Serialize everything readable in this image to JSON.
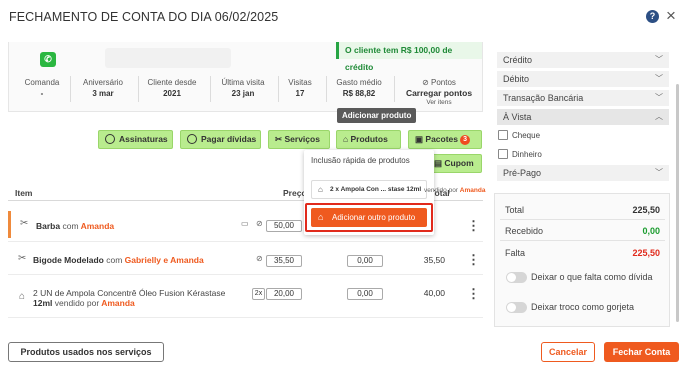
{
  "header": {
    "title": "FECHAMENTO DE CONTA DO DIA 06/02/2025",
    "help": "?",
    "close": "×"
  },
  "client": {
    "credit_banner": "O cliente tem R$ 100,00 de crédito",
    "stats": [
      {
        "label": "Comanda",
        "value": "-"
      },
      {
        "label": "Aniversário",
        "value": "3 mar"
      },
      {
        "label": "Cliente desde",
        "value": "2021"
      },
      {
        "label": "Última visita",
        "value": "23 jan"
      },
      {
        "label": "Visitas",
        "value": "17"
      },
      {
        "label": "Gasto médio",
        "value": "R$ 88,82"
      }
    ],
    "points": {
      "label": "Pontos",
      "button": "Carregar pontos",
      "link": "Ver itens"
    }
  },
  "tooltip": "Adicionar produto",
  "actions": {
    "assinaturas": "Assinaturas",
    "pagar_dividas": "Pagar dívidas",
    "servicos": "Serviços",
    "produtos": "Produtos",
    "pacotes": "Pacotes",
    "pacotes_badge": "3",
    "cupom": "Cupom"
  },
  "dropdown": {
    "title": "Inclusão rápida de produtos",
    "item": "2 x Ampola Con ... stase 12ml",
    "item_tail_prefix": "vendido por",
    "item_tail_name": "Amanda",
    "add_button": "Adicionar outro produto"
  },
  "table": {
    "headers": {
      "item": "Item",
      "price": "Preço",
      "total": "Total"
    },
    "rows": [
      {
        "name": "Barba",
        "connector": "com",
        "pro": "Amanda",
        "price": "50,00",
        "discount": "",
        "total": ""
      },
      {
        "name": "Bigode Modelado",
        "connector": "com",
        "pro": "Gabrielly e Amanda",
        "price": "35,50",
        "discount": "0,00",
        "total": "35,50"
      },
      {
        "line1": "2 UN de Ampola Concentrê Óleo Fusion Kérastase",
        "line2": "12ml",
        "connector": "vendido por",
        "pro": "Amanda",
        "qty": "2x",
        "price": "20,00",
        "discount": "0,00",
        "total": "40,00"
      }
    ]
  },
  "footer": {
    "produtos_usados": "Produtos usados nos serviços",
    "cancelar": "Cancelar",
    "fechar": "Fechar Conta"
  },
  "payment": {
    "methods": [
      "Crédito",
      "Débito",
      "Transação Bancária",
      "À Vista"
    ],
    "avista_options": [
      "Cheque",
      "Dinheiro"
    ],
    "last_method": "Pré-Pago"
  },
  "summary": {
    "total_label": "Total",
    "total_value": "225,50",
    "recebido_label": "Recebido",
    "recebido_value": "0,00",
    "falta_label": "Falta",
    "falta_value": "225,50",
    "toggle1": "Deixar o que falta como dívida",
    "toggle2": "Deixar troco como gorjeta"
  },
  "colors": {
    "accent": "#ef5a1f",
    "action_green": "#b9ec8e",
    "credit_green": "#1f8a37",
    "danger": "#e12a1c"
  }
}
